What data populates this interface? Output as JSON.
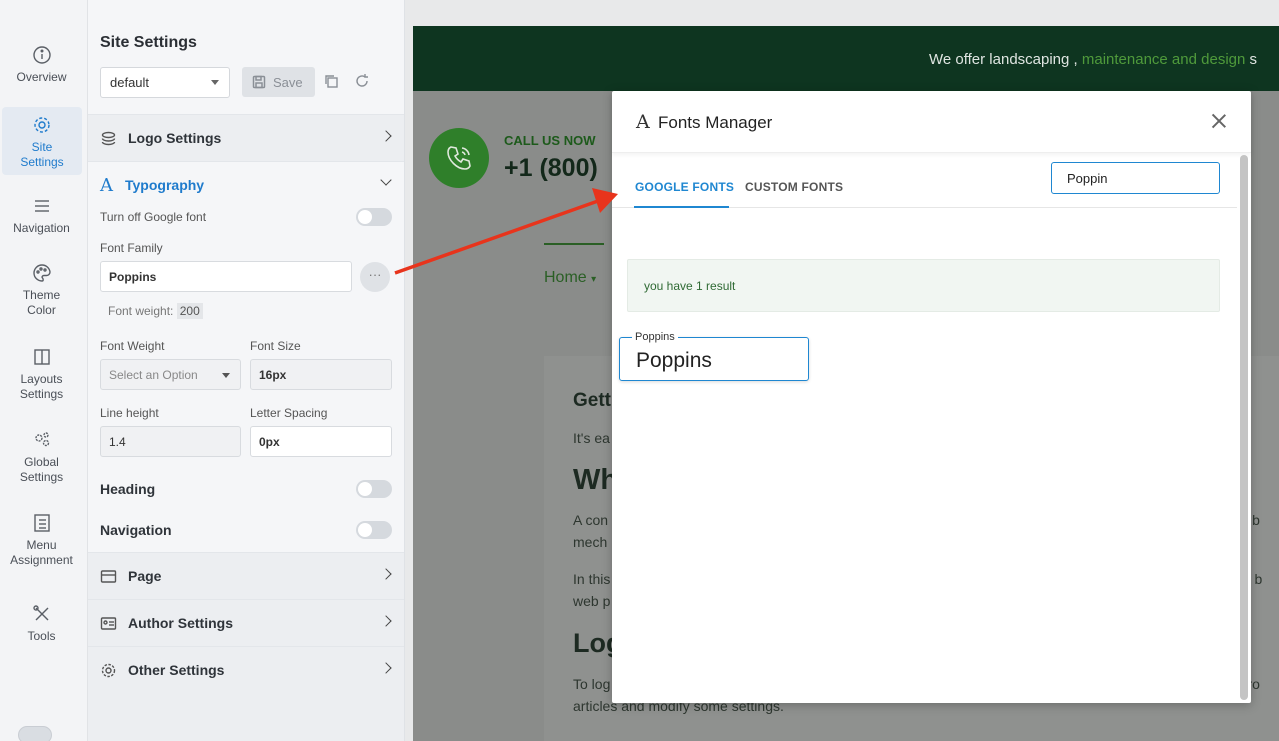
{
  "rail": {
    "items": [
      {
        "label": "Overview",
        "icon": "info-icon"
      },
      {
        "label": "Site Settings",
        "icon": "gear-icon",
        "active": true
      },
      {
        "label": "Navigation",
        "icon": "menu-icon"
      },
      {
        "label": "Theme Color",
        "icon": "palette-icon"
      },
      {
        "label": "Layouts Settings",
        "icon": "layout-icon"
      },
      {
        "label": "Global Settings",
        "icon": "gears-icon"
      },
      {
        "label": "Menu Assignment",
        "icon": "list-icon"
      },
      {
        "label": "Tools",
        "icon": "tools-icon"
      }
    ]
  },
  "panel": {
    "title": "Site Settings",
    "preset": "default",
    "save_label": "Save",
    "sections": {
      "logo": "Logo Settings",
      "typography": "Typography",
      "page": "Page",
      "author": "Author Settings",
      "other": "Other Settings"
    },
    "typography": {
      "google_font_toggle_label": "Turn off Google font",
      "font_family_label": "Font Family",
      "font_family_value": "Poppins",
      "font_weight_note_label": "Font weight:",
      "font_weight_note_value": "200",
      "font_weight_label": "Font Weight",
      "font_weight_placeholder": "Select an Option",
      "font_size_label": "Font Size",
      "font_size_value": "16px",
      "line_height_label": "Line height",
      "line_height_value": "1.4",
      "letter_spacing_label": "Letter Spacing",
      "letter_spacing_value": "0px",
      "heading_label": "Heading",
      "navigation_label": "Navigation"
    }
  },
  "site": {
    "topbar_text_start": "We offer landscaping , ",
    "topbar_text_highlight": "maintenance and design",
    "topbar_text_end": " s",
    "call_us": "CALL US NOW",
    "phone": "+1 (800)",
    "nav_home": "Home",
    "content": {
      "h1": "Gett",
      "p1": "It's ea",
      "h2": "Wh",
      "p2a": "A con",
      "p2a_right": "sily b",
      "p2b": "mech",
      "p3a": "In this",
      "p3a_right": "ala! b",
      "p3b": "web p",
      "h3": "Log",
      "p4a": "To log",
      "p4a_right": "n pro",
      "p4b": "articles and modify some settings."
    }
  },
  "modal": {
    "title": "Fonts Manager",
    "tabs": [
      "GOOGLE FONTS",
      "CUSTOM FONTS"
    ],
    "search_value": "Poppin",
    "result_text": "you have 1 result",
    "font_card": {
      "legend": "Poppins",
      "sample": "Poppins"
    }
  },
  "colors": {
    "accent": "#1f87d1",
    "brand_dark": "#0e3520",
    "brand_green": "#2f7f2a",
    "arrow": "#e8341c"
  }
}
